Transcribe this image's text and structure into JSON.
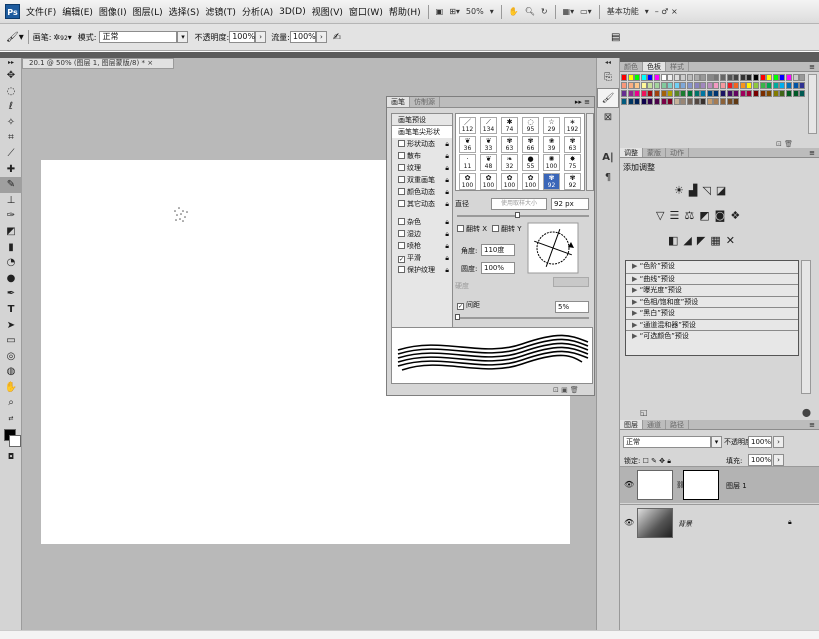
{
  "app": {
    "logo": "Ps"
  },
  "menu": [
    "文件(F)",
    "编辑(E)",
    "图像(I)",
    "图层(L)",
    "选择(S)",
    "滤镜(T)",
    "分析(A)",
    "3D(D)",
    "视图(V)",
    "窗口(W)",
    "帮助(H)"
  ],
  "menubar_right": {
    "zoom": "50%",
    "workspace": "基本功能",
    "win_controls": "– ♂ ×"
  },
  "options": {
    "brush_label": "画笔:",
    "brush_size": "92",
    "mode_label": "模式:",
    "mode_value": "正常",
    "opacity_label": "不透明度:",
    "opacity_value": "100%",
    "flow_label": "流量:",
    "flow_value": "100%"
  },
  "document": {
    "tab_title": "20.1 @ 50% (图层 1, 图层蒙版/8) *"
  },
  "brush_panel": {
    "tabs": [
      "画笔",
      "仿制源"
    ],
    "presets_label": "画笔预设",
    "tip_shape_label": "画笔笔尖形状",
    "options": [
      {
        "label": "形状动态",
        "checked": false
      },
      {
        "label": "散布",
        "checked": false
      },
      {
        "label": "纹理",
        "checked": false
      },
      {
        "label": "双重画笔",
        "checked": false
      },
      {
        "label": "颜色动态",
        "checked": false
      },
      {
        "label": "其它动态",
        "checked": false
      },
      {
        "label": "杂色",
        "checked": false
      },
      {
        "label": "湿边",
        "checked": false
      },
      {
        "label": "喷枪",
        "checked": false
      },
      {
        "label": "平滑",
        "checked": true
      },
      {
        "label": "保护纹理",
        "checked": false
      }
    ],
    "tip_sizes": [
      "112",
      "134",
      "74",
      "95",
      "29",
      "192",
      "36",
      "33",
      "63",
      "66",
      "39",
      "63",
      "11",
      "48",
      "32",
      "55",
      "100",
      "75",
      "100",
      "100",
      "100",
      "100",
      "92",
      "92"
    ],
    "diameter_label": "直径",
    "use_sample_label": "使用取样大小",
    "diameter_value": "92 px",
    "flip_x_label": "翻转 X",
    "flip_y_label": "翻转 Y",
    "angle_label": "角度:",
    "angle_value": "110度",
    "roundness_label": "圆度:",
    "roundness_value": "100%",
    "hardness_label": "硬度",
    "spacing_label": "间距",
    "spacing_value": "5%"
  },
  "swatches_panel": {
    "tabs": [
      "颜色",
      "色板",
      "样式"
    ]
  },
  "adjustments_panel": {
    "tabs": [
      "调整",
      "蒙版",
      "动作"
    ],
    "title": "添加调整",
    "presets": [
      "“色阶”预设",
      "“曲线”预设",
      "“曝光度”预设",
      "“色相/饱和度”预设",
      "“黑白”预设",
      "“通道混和器”预设",
      "“可选颜色”预设"
    ]
  },
  "layers_panel": {
    "tabs": [
      "图层",
      "通道",
      "路径"
    ],
    "blend_mode": "正常",
    "opacity_label": "不透明度:",
    "opacity_value": "100%",
    "lock_label": "锁定:",
    "fill_label": "填充:",
    "fill_value": "100%",
    "layers": [
      {
        "name": "图层 1"
      },
      {
        "name": "背景"
      }
    ]
  }
}
